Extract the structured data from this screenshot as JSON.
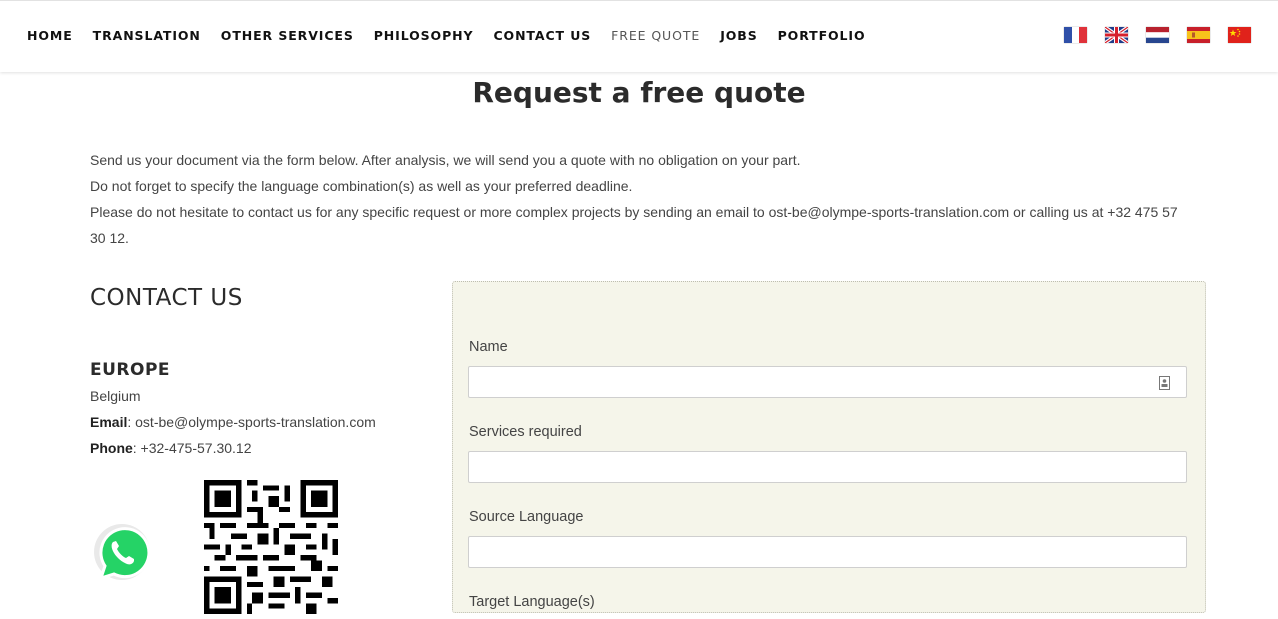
{
  "nav": {
    "items": [
      {
        "label": "HOME"
      },
      {
        "label": "TRANSLATION"
      },
      {
        "label": "OTHER SERVICES"
      },
      {
        "label": "PHILOSOPHY"
      },
      {
        "label": "CONTACT US"
      },
      {
        "label": "FREE QUOTE",
        "active": true
      },
      {
        "label": "JOBS"
      },
      {
        "label": "PORTFOLIO"
      }
    ],
    "flags": [
      "france-flag-icon",
      "uk-flag-icon",
      "netherlands-flag-icon",
      "spain-flag-icon",
      "china-flag-icon"
    ]
  },
  "page": {
    "title": "Request a free quote",
    "intro": [
      "Send us your document via the form below. After analysis, we will send you a quote with no obligation on your part.",
      "Do not forget to specify the language combination(s) as well as your preferred deadline.",
      "Please do not hesitate to contact us for any specific request or more complex projects by sending an email to ost-be@olympe-sports-translation.com or calling us at +32 475 57 30 12."
    ]
  },
  "contact": {
    "heading": "CONTACT US",
    "region": "EUROPE",
    "country": "Belgium",
    "email_label": "Email",
    "email": ": ost-be@olympe-sports-translation.com",
    "phone_label": "Phone",
    "phone": ": +32-475-57.30.12"
  },
  "form": {
    "fields": [
      {
        "label": "Name",
        "value": ""
      },
      {
        "label": "Services required",
        "value": ""
      },
      {
        "label": "Source Language",
        "value": ""
      },
      {
        "label": "Target Language(s)",
        "value": ""
      }
    ]
  },
  "colors": {
    "form_background": "#f5f5ea",
    "whatsapp_green": "#25d366"
  }
}
